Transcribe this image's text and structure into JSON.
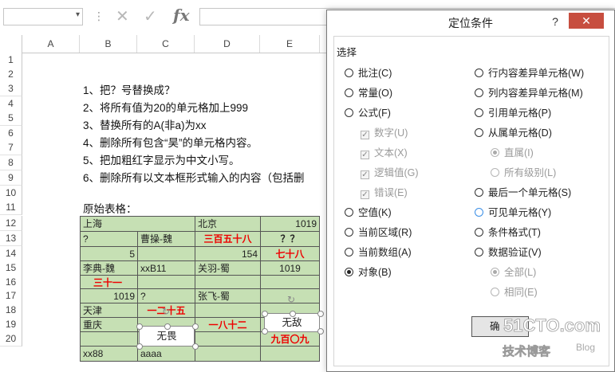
{
  "formula_bar": {
    "name_box": "",
    "cancel_icon": "✕",
    "enter_icon": "✓",
    "fx_label": "fx",
    "formula": ""
  },
  "columns": [
    "A",
    "B",
    "C",
    "D",
    "E"
  ],
  "rows": [
    "1",
    "2",
    "3",
    "4",
    "5",
    "6",
    "7",
    "8",
    "9",
    "10",
    "11",
    "12",
    "13",
    "14",
    "15",
    "16",
    "17",
    "18",
    "19",
    "20"
  ],
  "instructions": [
    "1、把？号替换成？",
    "2、将所有值为20的单元格加上999",
    "3、替换所有的A(非a)为xx",
    "4、删除所有包含“昊”的单元格内容。",
    "5、把加粗红字显示为中文小写。",
    "6、删除所有以文本框形式输入的内容（包括删"
  ],
  "table_title": "原始表格：",
  "table": {
    "r11": [
      "上海",
      "",
      "北京",
      "1019"
    ],
    "r12": [
      "?",
      "曹操-魏",
      "三百五十八",
      "？？"
    ],
    "r13": [
      "5",
      "",
      "154",
      "七十八"
    ],
    "r14": [
      "李典-魏",
      "xxB11",
      "关羽-蜀",
      "1019"
    ],
    "r15": [
      "三十一",
      "",
      "",
      ""
    ],
    "r16": [
      "1019",
      "?",
      "张飞-蜀",
      ""
    ],
    "r17": [
      "天津",
      "一二十五",
      "",
      ""
    ],
    "r18": [
      "重庆",
      "",
      "一八十二",
      ""
    ],
    "r19": [
      "",
      "",
      "",
      "九百〇九"
    ],
    "r20": [
      "xx88",
      "aaaa",
      "",
      ""
    ]
  },
  "textboxes": {
    "tb1": "无畏",
    "tb2": "无敌"
  },
  "right_partial": {
    "r20": "xx88"
  },
  "dialog": {
    "title": "定位条件",
    "help": "?",
    "close": "✕",
    "group_label": "选择",
    "left_options": [
      {
        "label": "批注(C)",
        "state": "off"
      },
      {
        "label": "常量(O)",
        "state": "off"
      },
      {
        "label": "公式(F)",
        "state": "off"
      },
      {
        "label": "数字(U)",
        "state": "check-dim"
      },
      {
        "label": "文本(X)",
        "state": "check-dim"
      },
      {
        "label": "逻辑值(G)",
        "state": "check-dim"
      },
      {
        "label": "错误(E)",
        "state": "check-dim"
      },
      {
        "label": "空值(K)",
        "state": "off"
      },
      {
        "label": "当前区域(R)",
        "state": "off"
      },
      {
        "label": "当前数组(A)",
        "state": "off"
      },
      {
        "label": "对象(B)",
        "state": "on"
      }
    ],
    "right_options": [
      {
        "label": "行内容差异单元格(W)",
        "state": "off"
      },
      {
        "label": "列内容差异单元格(M)",
        "state": "off"
      },
      {
        "label": "引用单元格(P)",
        "state": "off"
      },
      {
        "label": "从属单元格(D)",
        "state": "off"
      },
      {
        "label": "直属(I)",
        "state": "dim-on"
      },
      {
        "label": "所有级别(L)",
        "state": "dim-off"
      },
      {
        "label": "最后一个单元格(S)",
        "state": "off"
      },
      {
        "label": "可见单元格(Y)",
        "state": "focus"
      },
      {
        "label": "条件格式(T)",
        "state": "off"
      },
      {
        "label": "数据验证(V)",
        "state": "off"
      },
      {
        "label": "全部(L)",
        "state": "dim-on"
      },
      {
        "label": "相同(E)",
        "state": "dim-off"
      }
    ],
    "ok": "确"
  },
  "watermark": {
    "line1": "51CTO.com",
    "line2": "技术博客",
    "line3": "Blog"
  },
  "colors": {
    "cell_green": "#c6e0b4",
    "red_text": "#ee0000",
    "close_red": "#c74e3f"
  }
}
